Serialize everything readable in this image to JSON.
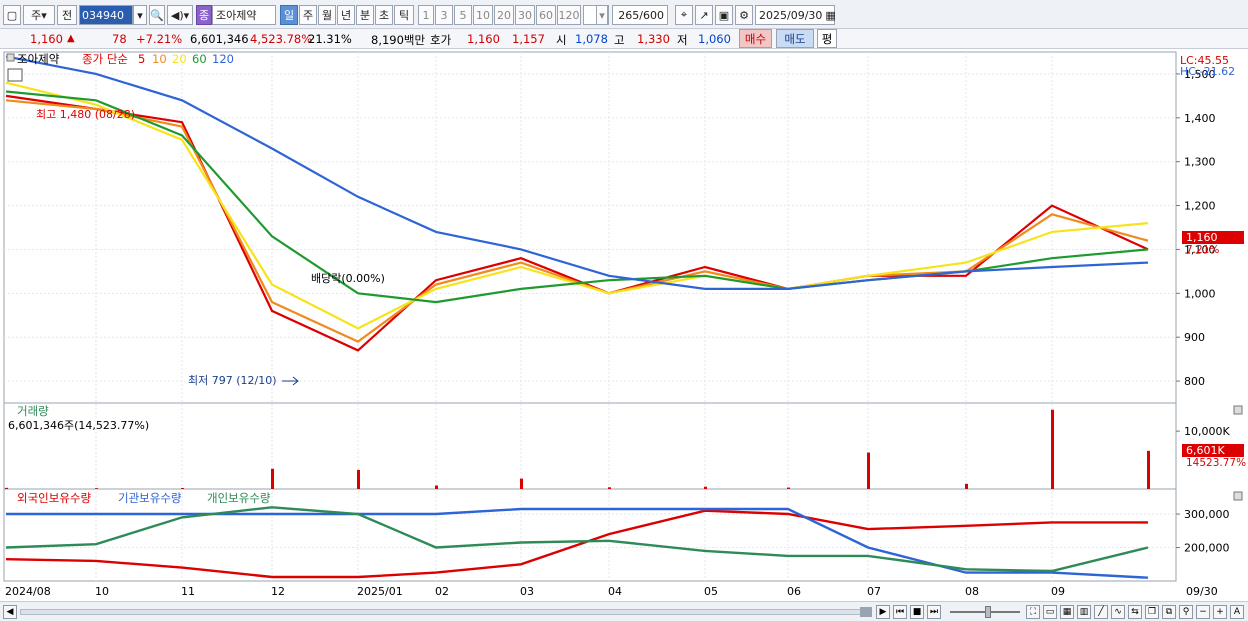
{
  "toolbar": {
    "market": "주",
    "prev": "전",
    "code": "034940",
    "tag": "종",
    "name": "조아제약",
    "periods": [
      "일",
      "주",
      "월",
      "년",
      "분",
      "초",
      "틱"
    ],
    "minutes": [
      "1",
      "3",
      "5",
      "10",
      "20",
      "30",
      "60",
      "120"
    ],
    "count": "265",
    "count_total": "/600",
    "date": "2025/09/30"
  },
  "quote": {
    "price": "1,160",
    "change": "78",
    "change_pct": "+7.21%",
    "volume": "6,601,346",
    "volume_pct": "4,523.78%",
    "turnover": "21.31%",
    "amount": "8,190백만",
    "ask_label": "호가",
    "ask": "1,160",
    "bid": "1,157",
    "open_label": "시",
    "open": "1,078",
    "high_label": "고",
    "high": "1,330",
    "low_label": "저",
    "low": "1,060",
    "buy_label": "매수",
    "sell_label": "매도",
    "eval_label": "평"
  },
  "price_panel": {
    "stock_name": "조아제약",
    "ma_label": "종가 단순",
    "ma_periods": [
      "5",
      "10",
      "20",
      "60",
      "120"
    ],
    "ma_colors": [
      "#dd0000",
      "#f08a1c",
      "#f7e31b",
      "#1e9a2e",
      "#2f64d6"
    ],
    "high_annotation": "최고 1,480 (08/28)",
    "low_annotation": "최저 797 (12/10)",
    "dividend_annotation": "배당락(0.00%)",
    "lc": "LC:45.55",
    "hc": "HC:-21.62",
    "price_badge": "1,160",
    "price_badge_pct": "7.21%"
  },
  "volume_panel": {
    "title": "거래량",
    "summary": "6,601,346주(14,523.77%)",
    "badge": "6,601K",
    "badge_pct": "14523.77%"
  },
  "holdings_panel": {
    "legend": [
      "외국인보유수량",
      "기관보유수량",
      "개인보유수량"
    ],
    "legend_colors": [
      "#dd0000",
      "#2f64d6",
      "#2e8b57"
    ]
  },
  "x_axis": {
    "labels": [
      "2024/08",
      "10",
      "11",
      "12",
      "2025/01",
      "02",
      "03",
      "04",
      "05",
      "06",
      "07",
      "08",
      "09"
    ],
    "end_label": "09/30"
  },
  "chart_data": [
    {
      "type": "line",
      "title": "",
      "ylim": [
        750,
        1550
      ],
      "y_ticks": [
        "1,500",
        "1,400",
        "1,300",
        "1,200",
        "1,100",
        "1,000",
        "900",
        "800"
      ],
      "x": [
        "2024/08",
        "10",
        "11",
        "12",
        "2025/01",
        "02",
        "03",
        "04",
        "05",
        "06",
        "07",
        "08",
        "09",
        "09/30"
      ],
      "series": [
        {
          "name": "5",
          "values": [
            1450,
            1420,
            1390,
            960,
            870,
            1030,
            1080,
            1000,
            1060,
            1010,
            1040,
            1040,
            1200,
            1100
          ]
        },
        {
          "name": "10",
          "values": [
            1440,
            1420,
            1380,
            980,
            890,
            1020,
            1070,
            1000,
            1050,
            1010,
            1040,
            1050,
            1180,
            1120
          ]
        },
        {
          "name": "20",
          "values": [
            1480,
            1430,
            1350,
            1020,
            920,
            1010,
            1060,
            1000,
            1040,
            1010,
            1040,
            1070,
            1140,
            1160
          ]
        },
        {
          "name": "60",
          "values": [
            1460,
            1440,
            1360,
            1130,
            1000,
            980,
            1010,
            1030,
            1040,
            1010,
            1030,
            1050,
            1080,
            1100
          ]
        },
        {
          "name": "120",
          "values": [
            1540,
            1500,
            1440,
            1330,
            1220,
            1140,
            1100,
            1040,
            1010,
            1010,
            1030,
            1050,
            1060,
            1070
          ]
        }
      ]
    },
    {
      "type": "bar",
      "title": "거래량",
      "y_ticks": [
        "10,000K"
      ],
      "x": [
        "2024/08",
        "10",
        "11",
        "12",
        "2025/01",
        "02",
        "03",
        "04",
        "05",
        "06",
        "07",
        "08",
        "09",
        "09/30"
      ],
      "values": [
        200,
        150,
        180,
        3500,
        3300,
        600,
        1800,
        300,
        400,
        250,
        6300,
        900,
        13700,
        6601
      ]
    },
    {
      "type": "line",
      "title": "",
      "ylim": [
        100000,
        330000
      ],
      "y_ticks": [
        "300,000",
        "200,000"
      ],
      "x": [
        "2024/08",
        "10",
        "11",
        "12",
        "2025/01",
        "02",
        "03",
        "04",
        "05",
        "06",
        "07",
        "08",
        "09",
        "09/30"
      ],
      "series": [
        {
          "name": "외국인보유수량",
          "values": [
            165000,
            160000,
            140000,
            112000,
            112000,
            125000,
            150000,
            240000,
            310000,
            300000,
            255000,
            265000,
            275000,
            275000
          ]
        },
        {
          "name": "기관보유수량",
          "values": [
            300000,
            300000,
            300000,
            300000,
            300000,
            300000,
            315000,
            315000,
            315000,
            315000,
            200000,
            125000,
            125000,
            110000
          ]
        },
        {
          "name": "개인보유수량",
          "values": [
            200000,
            210000,
            290000,
            320000,
            300000,
            200000,
            215000,
            220000,
            190000,
            175000,
            175000,
            135000,
            130000,
            200000
          ]
        }
      ]
    }
  ]
}
